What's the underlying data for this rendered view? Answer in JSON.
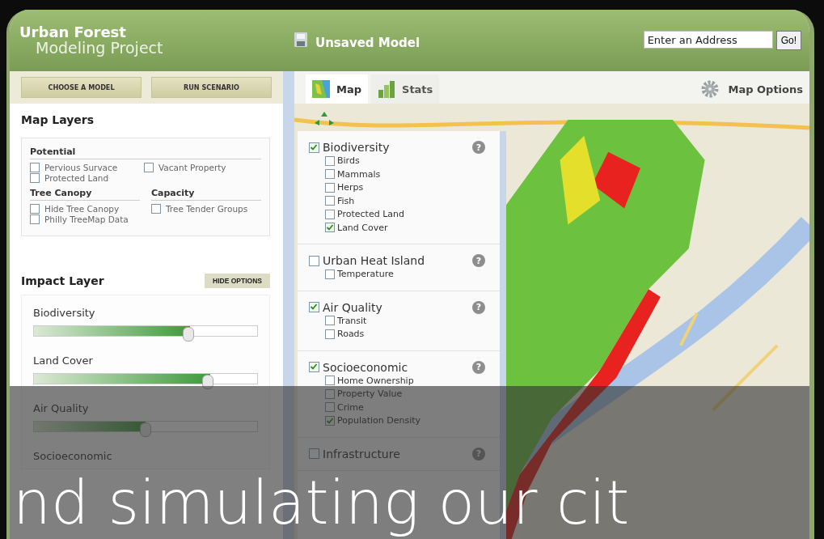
{
  "header": {
    "logo_line_1": "Urban Forest",
    "logo_line_2": "Modeling Project",
    "model_title": "Unsaved Model",
    "address": {
      "placeholder": "Enter an Address"
    },
    "go_button": "Go!"
  },
  "toolbar": {
    "buttons": [
      "CHOOSE A MODEL",
      "RUN SCENARIO"
    ]
  },
  "tabs": [
    {
      "label": "Map",
      "selected": true,
      "kind": "map"
    },
    {
      "label": "Stats",
      "selected": false,
      "kind": "stats"
    }
  ],
  "map_options": "Map Options",
  "map_layers": {
    "title": "Map Layers",
    "rows": [
      {
        "groups": [
          {
            "title": "Potential",
            "items": [
              {
                "label": "Pervious Survace",
                "checked": false
              },
              {
                "label": "Protected Land",
                "checked": false
              },
              {
                "label": "Vacant Property",
                "checked": false
              }
            ]
          }
        ]
      },
      {
        "groups": [
          {
            "title": "Tree Canopy",
            "items": [
              {
                "label": "Hide Tree Canopy",
                "checked": false
              },
              {
                "label": "Philly TreeMap Data",
                "checked": false
              }
            ]
          },
          {
            "title": "Capacity",
            "items": [
              {
                "label": "Tree Tender Groups",
                "checked": false
              }
            ]
          }
        ]
      }
    ]
  },
  "impact_layer": {
    "title": "Impact Layer",
    "hide_button": "HIDE OPTIONS",
    "sliders": [
      {
        "name": "Biodiversity",
        "level": 0.7
      },
      {
        "name": "Land Cover",
        "level": 0.79
      },
      {
        "name": "Air Quality",
        "level": 0.5
      },
      {
        "name": "Socioeconomic"
      }
    ]
  },
  "layer_panel": [
    {
      "name": "Biodiversity",
      "checked": true,
      "help": "?",
      "children": [
        {
          "name": "Birds",
          "checked": false
        },
        {
          "name": "Mammals",
          "checked": false
        },
        {
          "name": "Herps",
          "checked": false
        },
        {
          "name": "Fish",
          "checked": false
        },
        {
          "name": "Protected Land",
          "checked": false
        },
        {
          "name": "Land Cover",
          "checked": true
        }
      ]
    },
    {
      "name": "Urban Heat Island",
      "checked": false,
      "help": "?",
      "children": [
        {
          "name": "Temperature",
          "checked": false
        }
      ]
    },
    {
      "name": "Air Quality",
      "checked": true,
      "help": "?",
      "children": [
        {
          "name": "Transit",
          "checked": false
        },
        {
          "name": "Roads",
          "checked": false
        }
      ]
    },
    {
      "name": "Socioeconomic",
      "checked": true,
      "help": "?",
      "children": [
        {
          "name": "Home Ownership",
          "checked": false
        },
        {
          "name": "Property Value",
          "checked": false
        },
        {
          "name": "Crime",
          "checked": false
        },
        {
          "name": "Population Density",
          "checked": true
        }
      ]
    },
    {
      "name": "Infrastructure",
      "checked": false,
      "help": "?"
    }
  ],
  "caption": "nd simulating our cit"
}
